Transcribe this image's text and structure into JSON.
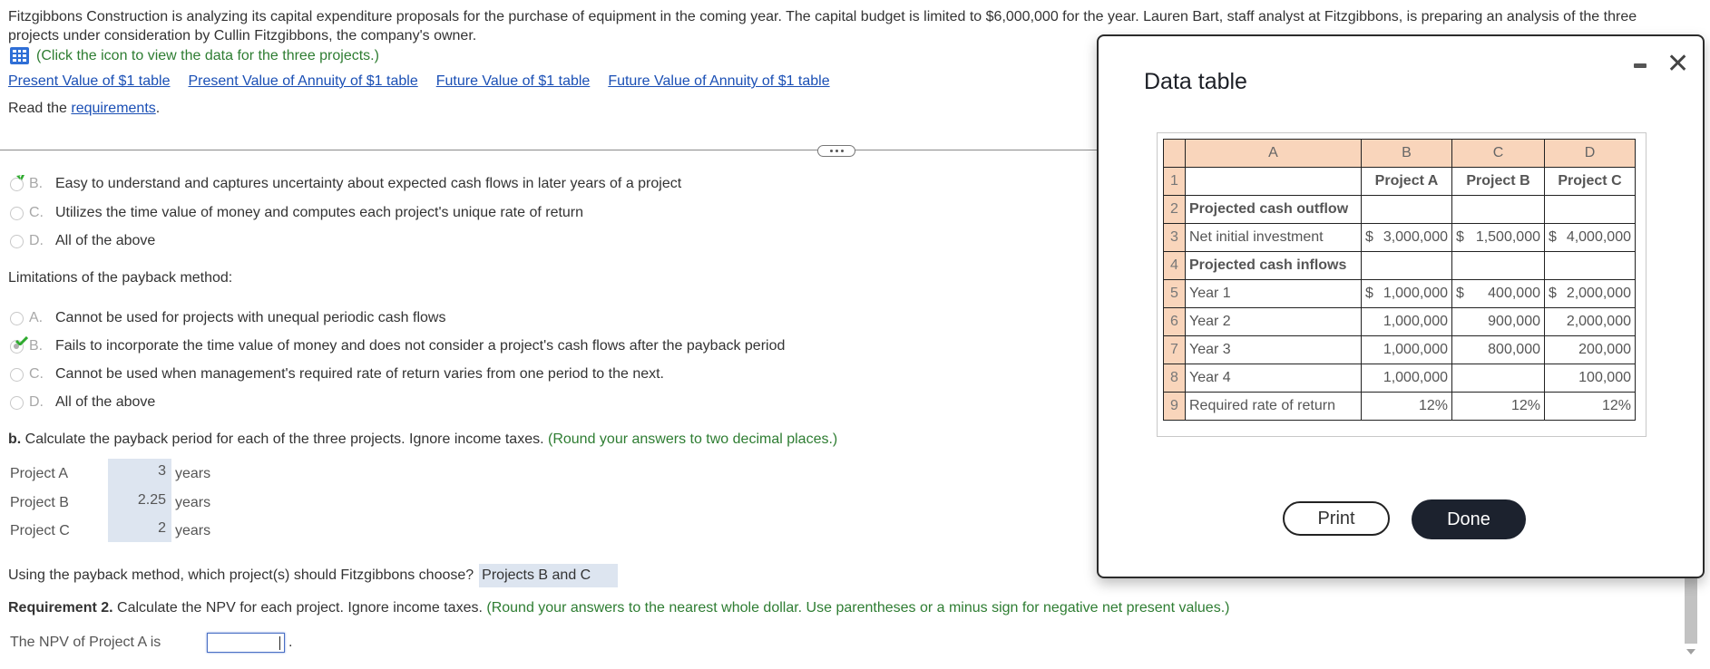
{
  "intro": {
    "text": "Fitzgibbons Construction is analyzing its capital expenditure proposals for the purchase of equipment in the coming year. The capital budget is limited to $6,000,000 for the year. Lauren Bart, staff analyst at Fitzgibbons, is preparing an analysis of the three projects under consideration by Cullin Fitzgibbons, the company's owner.",
    "data_hint": "(Click the icon to view the data for the three projects.)",
    "data_icon": "grid-table-icon"
  },
  "links": [
    "Present Value of $1 table",
    "Present Value of Annuity of $1 table",
    "Future Value of $1 table",
    "Future Value of Annuity of $1 table"
  ],
  "requirements": {
    "prefix": "Read the ",
    "link": "requirements",
    "suffix": "."
  },
  "advantages_options": [
    {
      "letter": "B.",
      "text": "Easy to understand and captures uncertainty about expected cash flows in later years of a project",
      "selected": true,
      "correct": true
    },
    {
      "letter": "C.",
      "text": "Utilizes the time value of money and computes each project's unique rate of return",
      "selected": false
    },
    {
      "letter": "D.",
      "text": "All of the above",
      "selected": false
    }
  ],
  "limitations": {
    "label": "Limitations of the payback method:",
    "options": [
      {
        "letter": "A.",
        "text": "Cannot be used for projects with unequal periodic cash flows",
        "selected": false
      },
      {
        "letter": "B.",
        "text": "Fails to incorporate the time value of money and does not consider a project's cash flows after the payback period",
        "selected": true,
        "correct": true
      },
      {
        "letter": "C.",
        "text": "Cannot be used when management's required rate of return varies from one period to the next.",
        "selected": false
      },
      {
        "letter": "D.",
        "text": "All of the above",
        "selected": false
      }
    ]
  },
  "part_b": {
    "bold": "b.",
    "text": " Calculate the payback period for each of the three projects. Ignore income taxes. ",
    "hint": "(Round your answers to two decimal places.)",
    "rows": [
      {
        "label": "Project A",
        "value": "3",
        "unit": "years"
      },
      {
        "label": "Project B",
        "value": "2.25",
        "unit": "years"
      },
      {
        "label": "Project C",
        "value": "2",
        "unit": "years"
      }
    ]
  },
  "choose": {
    "question": "Using the payback method, which project(s) should Fitzgibbons choose?",
    "answer": "Projects B and C"
  },
  "requirement2": {
    "bold": "Requirement 2.",
    "text": " Calculate the NPV for each project. Ignore income taxes. ",
    "hint": "(Round your answers to the nearest whole dollar. Use parentheses or a minus sign for negative net present values.)"
  },
  "npv": {
    "label": "The NPV of Project A is",
    "value": "",
    "suffix": "."
  },
  "modal": {
    "title": "Data table",
    "minimize_icon": "minimize-icon",
    "close_icon": "close-icon",
    "close_glyph": "✕",
    "columns": [
      "A",
      "B",
      "C",
      "D"
    ],
    "rows": [
      {
        "n": "1",
        "label": "",
        "bold": false,
        "b": "Project A",
        "c": "Project B",
        "d": "Project C",
        "header": true
      },
      {
        "n": "2",
        "label": "Projected cash outflow",
        "bold": true,
        "b": "",
        "c": "",
        "d": ""
      },
      {
        "n": "3",
        "label": "Net initial investment",
        "bold": false,
        "b": "3,000,000",
        "c": "1,500,000",
        "d": "4,000,000",
        "dollar": true
      },
      {
        "n": "4",
        "label": "Projected cash inflows",
        "bold": true,
        "b": "",
        "c": "",
        "d": ""
      },
      {
        "n": "5",
        "label": "Year 1",
        "bold": false,
        "b": "1,000,000",
        "c": "400,000",
        "d": "2,000,000",
        "dollar": true
      },
      {
        "n": "6",
        "label": "Year 2",
        "bold": false,
        "b": "1,000,000",
        "c": "900,000",
        "d": "2,000,000"
      },
      {
        "n": "7",
        "label": "Year 3",
        "bold": false,
        "b": "1,000,000",
        "c": "800,000",
        "d": "200,000"
      },
      {
        "n": "8",
        "label": "Year 4",
        "bold": false,
        "b": "1,000,000",
        "c": "",
        "d": "100,000"
      },
      {
        "n": "9",
        "label": "Required rate of return",
        "bold": false,
        "b": "12%",
        "c": "12%",
        "d": "12%"
      }
    ],
    "currency": "$",
    "print_label": "Print",
    "done_label": "Done"
  },
  "colors": {
    "link": "#1a4fb5",
    "hint_green": "#2e7d32",
    "table_header": "#f9d5bb",
    "answer_bg": "#dde5f0",
    "done_bg": "#1c222e",
    "check_green": "#2eaa2e"
  }
}
